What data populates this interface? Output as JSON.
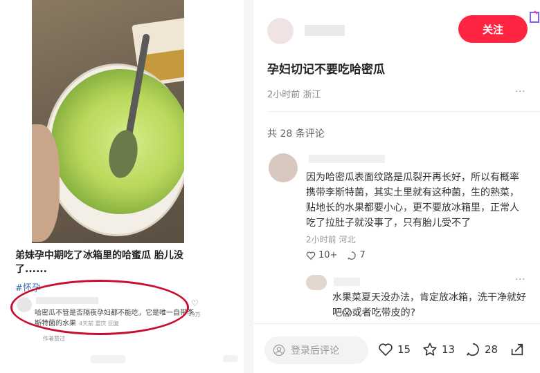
{
  "left": {
    "post_title": "弟妹孕中期吃了冰箱里的哈蜜瓜 胎儿没了......",
    "post_tag": "#怀孕",
    "comment": {
      "text": "哈密瓜不管是否隔夜孕妇都不能吃，它是唯一自带李斯特菌的水果",
      "meta": "4天前 重庆 回复",
      "likes": ".9万"
    },
    "author_liked": "作者赞过"
  },
  "right": {
    "follow_label": "关注",
    "note_title": "孕妇切记不要吃哈密瓜",
    "note_meta": "2小时前 浙江",
    "more_label": "···",
    "comment_count": "共 28 条评论",
    "top_comment": {
      "text": "因为哈密瓜表面纹路是瓜裂开再长好，所以有概率携带李斯特菌，其实土里就有这种菌，生的熟菜，贴地长的水果都要小心，更不要放冰箱里，正常人吃了拉肚子就没事了，只有胎儿受不了",
      "meta": "2小时前 河北",
      "likes": "10+",
      "replies": "7"
    },
    "reply": {
      "text_part1": "水果菜夏天没办法，肯定放冰箱，洗干净就好吧",
      "text_part2": "或者吃带皮的?"
    },
    "bottom": {
      "input_placeholder": "登录后评论",
      "likes": "15",
      "favorites": "13",
      "comments": "28"
    }
  },
  "colors": {
    "accent": "#ff2442",
    "annotation": "#c8102e",
    "tag": "#3b6bb0"
  },
  "icons": [
    "heart-icon",
    "comment-icon",
    "star-icon",
    "share-icon",
    "user-icon",
    "emoji-icon",
    "more-icon"
  ]
}
